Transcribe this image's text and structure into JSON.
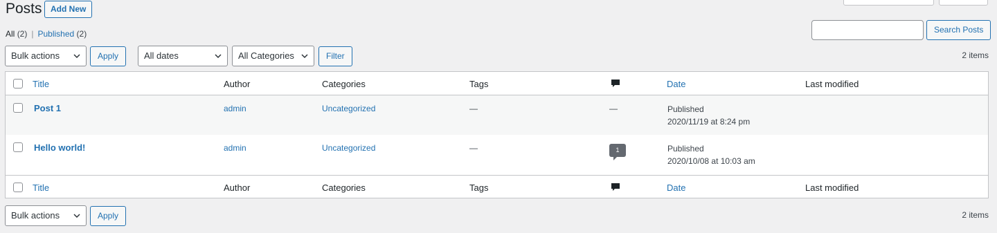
{
  "header": {
    "title": "Posts",
    "add_new_label": "Add New"
  },
  "filters_nav": {
    "all_label": "All",
    "all_count": "(2)",
    "separator": "|",
    "published_label": "Published",
    "published_count": "(2)"
  },
  "search": {
    "value": "",
    "button_label": "Search Posts"
  },
  "tablenav_top": {
    "bulk_actions": "Bulk actions",
    "apply_label": "Apply",
    "dates": "All dates",
    "categories": "All Categories",
    "filter_label": "Filter",
    "items_count": "2 items"
  },
  "table": {
    "columns": {
      "title": "Title",
      "author": "Author",
      "categories": "Categories",
      "tags": "Tags",
      "comments_icon": "comment-icon",
      "date": "Date",
      "last_modified": "Last modified"
    },
    "rows": [
      {
        "title": "Post 1",
        "author": "admin",
        "categories": "Uncategorized",
        "tags": "—",
        "comments": "—",
        "status": "Published",
        "date": "2020/11/19 at 8:24 pm"
      },
      {
        "title": "Hello world!",
        "author": "admin",
        "categories": "Uncategorized",
        "tags": "—",
        "comments": "1",
        "status": "Published",
        "date": "2020/10/08 at 10:03 am"
      }
    ]
  },
  "tablenav_bottom": {
    "bulk_actions": "Bulk actions",
    "apply_label": "Apply",
    "items_count": "2 items"
  },
  "colors": {
    "background": "#f0f0f1",
    "link": "#2271b1",
    "border": "#c3c4c7",
    "comment_badge": "#646970"
  }
}
